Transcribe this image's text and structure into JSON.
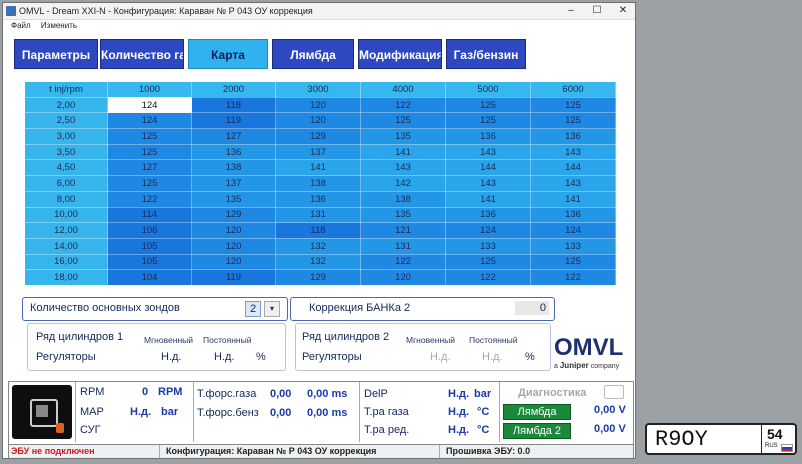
{
  "window": {
    "title": "OMVL - Dream XXI-N - Конфигурация: Караван № Р 043 ОУ коррекция",
    "menu": [
      "Файл",
      "Изменить"
    ]
  },
  "tabs": [
    {
      "label": "Параметры"
    },
    {
      "label": "Количество газа"
    },
    {
      "label": "Карта"
    },
    {
      "label": "Лямбда"
    },
    {
      "label": "Модификация смеси"
    },
    {
      "label": "Газ/бензин"
    }
  ],
  "map_table": {
    "corner": "t inj/rpm",
    "rpm": [
      "1000",
      "2000",
      "3000",
      "4000",
      "5000",
      "6000"
    ],
    "rows": [
      {
        "t": "2,00",
        "v": [
          "124",
          "118",
          "120",
          "122",
          "125",
          "125"
        ]
      },
      {
        "t": "2,50",
        "v": [
          "124",
          "119",
          "120",
          "125",
          "125",
          "125"
        ]
      },
      {
        "t": "3,00",
        "v": [
          "125",
          "127",
          "129",
          "135",
          "136",
          "136"
        ]
      },
      {
        "t": "3,50",
        "v": [
          "125",
          "136",
          "137",
          "141",
          "143",
          "143"
        ]
      },
      {
        "t": "4,50",
        "v": [
          "127",
          "138",
          "141",
          "143",
          "144",
          "144"
        ]
      },
      {
        "t": "6,00",
        "v": [
          "125",
          "137",
          "138",
          "142",
          "143",
          "143"
        ]
      },
      {
        "t": "8,00",
        "v": [
          "122",
          "135",
          "136",
          "138",
          "141",
          "141"
        ]
      },
      {
        "t": "10,00",
        "v": [
          "114",
          "129",
          "131",
          "135",
          "136",
          "136"
        ]
      },
      {
        "t": "12,00",
        "v": [
          "106",
          "120",
          "118",
          "121",
          "124",
          "124"
        ]
      },
      {
        "t": "14,00",
        "v": [
          "105",
          "120",
          "132",
          "131",
          "133",
          "133"
        ]
      },
      {
        "t": "16,00",
        "v": [
          "105",
          "120",
          "132",
          "122",
          "125",
          "125"
        ]
      },
      {
        "t": "18,00",
        "v": [
          "104",
          "119",
          "129",
          "120",
          "122",
          "122"
        ]
      }
    ]
  },
  "sensors": {
    "label": "Количество основных зондов",
    "value": "2"
  },
  "bank": {
    "label": "Коррекция БАНКа 2",
    "value": "0"
  },
  "bank1": {
    "title": "Ряд цилиндров 1",
    "col1": "Мгновенный",
    "col2": "Постоянный",
    "regulators": "Регуляторы",
    "v1": "Н.д.",
    "v2": "Н.д.",
    "unit": "%"
  },
  "bank2": {
    "title": "Ряд цилиндров 2",
    "col1": "Мгновенный",
    "col2": "Постоянный",
    "regulators": "Регуляторы",
    "v1": "Н.д.",
    "v2": "Н.д.",
    "unit": "%"
  },
  "brand": {
    "logo": "OMVL",
    "tagline_prefix": "a",
    "tagline_brand": "Juniper",
    "tagline_suffix": "company"
  },
  "readouts": {
    "rpm_label": "RPM",
    "rpm_value": "0",
    "rpm_unit": "RPM",
    "map_label": "MAP",
    "map_value": "Н.д.",
    "map_unit": "bar",
    "sug_label": "СУГ",
    "gas_inj_label": "Т.форс.газа",
    "gas_inj_value": "0,00",
    "gas_inj_ms": "0,00 ms",
    "pet_inj_label": "Т.форс.бенз",
    "pet_inj_value": "0,00",
    "pet_inj_ms": "0,00 ms",
    "delp_label": "DelP",
    "delp_value": "Н.д.",
    "delp_unit": "bar",
    "tgas_label": "Т.ра газа",
    "tgas_value": "Н.д.",
    "tgas_unit": "°C",
    "tred_label": "Т.ра ред.",
    "tred_value": "Н.д.",
    "tred_unit": "°C",
    "diag": "Диагностика",
    "lambda_btn": "Лямбда",
    "lambda_value": "0,00 V",
    "lambda2_btn": "Лямбда 2",
    "lambda2_value": "0,00 V"
  },
  "status": {
    "ecu": "ЭБУ не подключен",
    "config": "Конфигурация: Караван № Р 043 ОУ коррекция",
    "firmware": "Прошивка ЭБУ: 0.0"
  },
  "plate": {
    "number": "R9OY",
    "region": "54",
    "country": "RUS"
  },
  "colors": {
    "tab_blue": "#2e48c0",
    "tab_active": "#2fb2ee",
    "cell_light": "#35b5ec",
    "cell_dark": "#1876dc",
    "status_red": "#d01818",
    "button_green": "#1a8a3a"
  }
}
